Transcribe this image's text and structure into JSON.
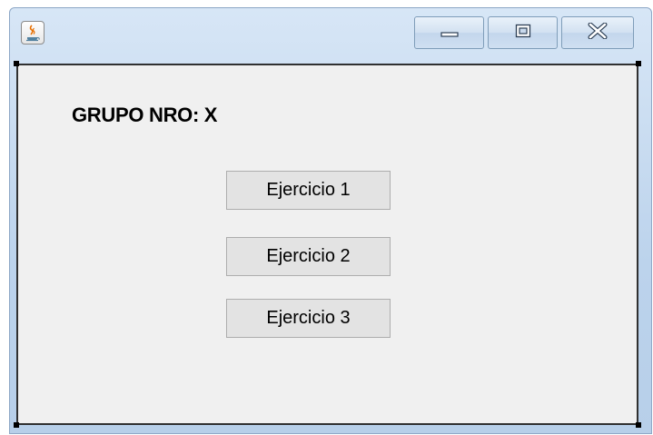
{
  "window": {
    "title_icon": "java-coffee-icon",
    "controls": {
      "minimize_icon": "minimize-icon",
      "maximize_icon": "maximize-icon",
      "close_icon": "close-icon"
    }
  },
  "content": {
    "group_label": "GRUPO NRO: X",
    "buttons": [
      {
        "label": "Ejercicio 1"
      },
      {
        "label": "Ejercicio 2"
      },
      {
        "label": "Ejercicio 3"
      }
    ]
  },
  "colors": {
    "titlebar": "#bcd3ec",
    "content_bg": "#f0f0f0",
    "button_bg": "#e3e3e3",
    "button_border": "#adadad"
  }
}
